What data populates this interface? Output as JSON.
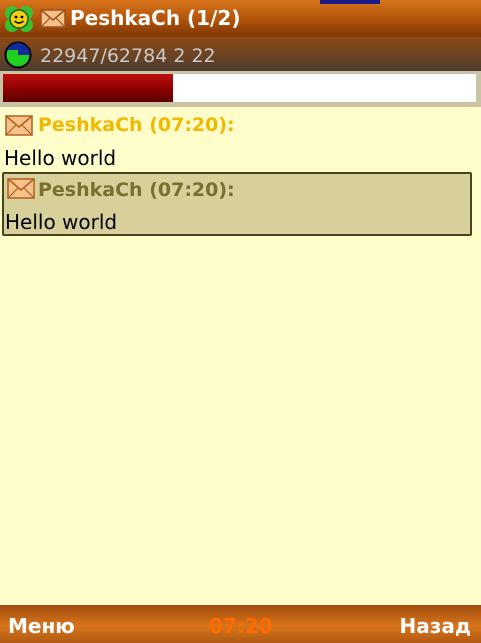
{
  "title_bar": {
    "title": "PeshkaCh (1/2)",
    "status_icon": "flower-smiley-icon",
    "message_icon": "envelope-icon"
  },
  "status_bar": {
    "traffic": "22947/62784 2 22",
    "icon": "moon-globe-icon"
  },
  "progress": {
    "fraction": 0.36
  },
  "messages": [
    {
      "sender": "PeshkaCh (07:20):",
      "text": "Hello world",
      "icon": "envelope-icon",
      "selected": false,
      "header_color": "#f0b800"
    },
    {
      "sender": "PeshkaCh (07:20):",
      "text": "Hello world",
      "icon": "envelope-icon",
      "selected": true,
      "header_color": "#7a6e30"
    }
  ],
  "softkeys": {
    "left": "Меню",
    "center": "07:20",
    "right": "Назад"
  },
  "colors": {
    "background": "#fffdc9",
    "accent": "#d8751c",
    "clock": "#ff6a00",
    "selected_row": "#d8d09a"
  }
}
